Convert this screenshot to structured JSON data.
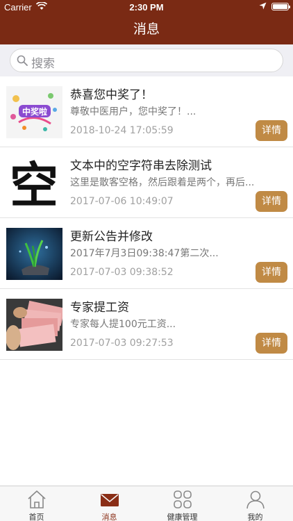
{
  "status_bar": {
    "carrier": "Carrier",
    "time": "2:30 PM"
  },
  "nav": {
    "title": "消息"
  },
  "search": {
    "placeholder": "搜索"
  },
  "messages": [
    {
      "title": "恭喜您中奖了！",
      "summary": "尊敬中医用户，您中奖了！...",
      "date": "2018-10-24 17:05:59",
      "button": "详情",
      "thumb_text": "中奖啦"
    },
    {
      "title": "文本中的空字符串去除测试",
      "summary": "这里是散客空格，然后跟着是两个，再后...",
      "date": "2017-07-06 10:49:07",
      "button": "详情",
      "thumb_text": "空"
    },
    {
      "title": "更新公告并修改",
      "summary": "2017年7月3日09:38:47第二次...",
      "date": "2017-07-03 09:38:52",
      "button": "详情"
    },
    {
      "title": "专家提工资",
      "summary": "专家每人提100元工资...",
      "date": "2017-07-03 09:27:53",
      "button": "详情"
    }
  ],
  "tabs": [
    {
      "label": "首页",
      "icon": "home-icon"
    },
    {
      "label": "消息",
      "icon": "envelope-icon",
      "active": true
    },
    {
      "label": "健康管理",
      "icon": "grid-icon"
    },
    {
      "label": "我的",
      "icon": "person-icon"
    }
  ],
  "colors": {
    "brand": "#7a2a14",
    "button": "#c08a45",
    "active_tab": "#8a2e16"
  }
}
